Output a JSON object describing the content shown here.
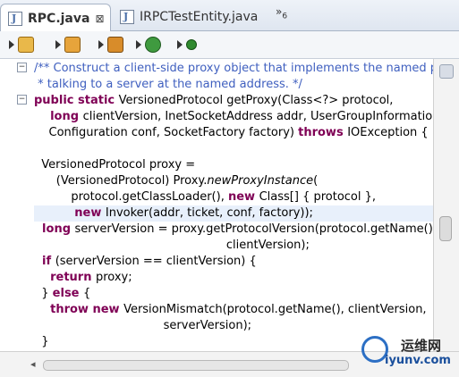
{
  "tabs": [
    {
      "label": "RPC.java",
      "close": "⊠",
      "active": true
    },
    {
      "label": "IRPCTestEntity.java",
      "active": false
    }
  ],
  "overflow": {
    "symbol": "»",
    "count": "6"
  },
  "code_lines": [
    {
      "segs": [
        {
          "t": "/** Construct a client-side ",
          "c": "com"
        },
        {
          "t": "proxy",
          "c": "com ul"
        },
        {
          "t": " object that implements the named protocol,",
          "c": "com"
        }
      ]
    },
    {
      "segs": [
        {
          "t": " * talking to a server at the named address. */",
          "c": "com"
        }
      ]
    },
    {
      "segs": [
        {
          "t": "public static ",
          "c": "kw"
        },
        {
          "t": "VersionedProtocol getProxy(Class<?> protocol,",
          "c": ""
        }
      ]
    },
    {
      "segs": [
        {
          "t": "    long ",
          "c": "kw"
        },
        {
          "t": "clientVersion, InetSocketAddress addr, UserGroupInformation ticket,",
          "c": ""
        }
      ]
    },
    {
      "segs": [
        {
          "t": "    Configuration conf, SocketFactory factory) ",
          "c": ""
        },
        {
          "t": "throws ",
          "c": "kw"
        },
        {
          "t": "IOException {",
          "c": ""
        }
      ]
    },
    {
      "segs": [
        {
          "t": "",
          "c": ""
        }
      ]
    },
    {
      "segs": [
        {
          "t": "  VersionedProtocol proxy =",
          "c": ""
        }
      ]
    },
    {
      "segs": [
        {
          "t": "      (VersionedProtocol) Proxy.",
          "c": ""
        },
        {
          "t": "newProxyInstance",
          "c": "it"
        },
        {
          "t": "(",
          "c": ""
        }
      ]
    },
    {
      "segs": [
        {
          "t": "          protocol.getClassLoader(), ",
          "c": ""
        },
        {
          "t": "new ",
          "c": "kw"
        },
        {
          "t": "Class[] { protocol },",
          "c": ""
        }
      ]
    },
    {
      "segs": [
        {
          "t": "          new ",
          "c": "kw"
        },
        {
          "t": "Invoker",
          "c": "ul"
        },
        {
          "t": "(addr, ticket, conf, factory));",
          "c": ""
        }
      ],
      "highlight": true
    },
    {
      "segs": [
        {
          "t": "  long ",
          "c": "kw"
        },
        {
          "t": "serverVersion = proxy.getProtocolVersion(protocol.getName(),",
          "c": ""
        }
      ]
    },
    {
      "segs": [
        {
          "t": "                                                    clientVersion);",
          "c": ""
        }
      ]
    },
    {
      "segs": [
        {
          "t": "  if ",
          "c": "kw"
        },
        {
          "t": "(serverVersion == clientVersion) {",
          "c": ""
        }
      ]
    },
    {
      "segs": [
        {
          "t": "    return ",
          "c": "kw"
        },
        {
          "t": "proxy;",
          "c": ""
        }
      ]
    },
    {
      "segs": [
        {
          "t": "  } ",
          "c": ""
        },
        {
          "t": "else ",
          "c": "kw"
        },
        {
          "t": "{",
          "c": ""
        }
      ]
    },
    {
      "segs": [
        {
          "t": "    throw new ",
          "c": "kw"
        },
        {
          "t": "VersionMismatch(protocol.getName(), clientVersion,",
          "c": ""
        }
      ]
    },
    {
      "segs": [
        {
          "t": "                                   serverVersion);",
          "c": ""
        }
      ]
    },
    {
      "segs": [
        {
          "t": "  }",
          "c": ""
        }
      ]
    }
  ],
  "watermark": {
    "line1": "运维网",
    "line2": "iyunv.com"
  },
  "colors": {
    "keyword": "#7f0055",
    "comment": "#3f5fbf",
    "highlight": "#e8f0fb"
  }
}
